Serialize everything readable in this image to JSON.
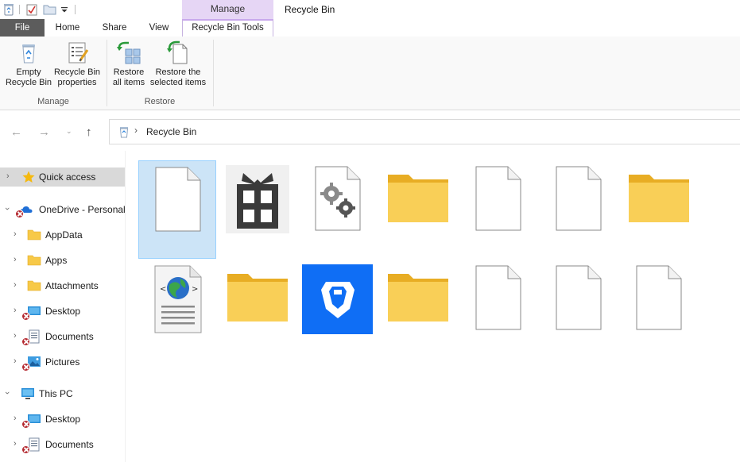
{
  "window": {
    "title": "Recycle Bin",
    "context_tab_group": "Manage"
  },
  "tabs": {
    "file": "File",
    "home": "Home",
    "share": "Share",
    "view": "View",
    "recycle_bin_tools": "Recycle Bin Tools"
  },
  "ribbon": {
    "manage_group": {
      "label": "Manage",
      "empty_line1": "Empty",
      "empty_line2": "Recycle Bin",
      "props_line1": "Recycle Bin",
      "props_line2": "properties"
    },
    "restore_group": {
      "label": "Restore",
      "all_line1": "Restore",
      "all_line2": "all items",
      "sel_line1": "Restore the",
      "sel_line2": "selected items"
    }
  },
  "address": {
    "path": "Recycle Bin"
  },
  "sidebar": {
    "items": [
      {
        "label": "Quick access"
      },
      {
        "label": "OneDrive - Personal"
      },
      {
        "label": "AppData"
      },
      {
        "label": "Apps"
      },
      {
        "label": "Attachments"
      },
      {
        "label": "Desktop"
      },
      {
        "label": "Documents"
      },
      {
        "label": "Pictures"
      },
      {
        "label": "This PC"
      },
      {
        "label": "Desktop"
      },
      {
        "label": "Documents"
      }
    ]
  },
  "content": {
    "items": [
      {
        "icon": "blank-file-icon"
      },
      {
        "icon": "gift-app-icon"
      },
      {
        "icon": "settings-file-icon"
      },
      {
        "icon": "folder-icon"
      },
      {
        "icon": "blank-file-icon"
      },
      {
        "icon": "blank-file-icon"
      },
      {
        "icon": "folder-icon"
      },
      {
        "icon": "html-document-icon"
      },
      {
        "icon": "folder-icon"
      },
      {
        "icon": "shield-app-icon"
      },
      {
        "icon": "folder-icon"
      },
      {
        "icon": "blank-file-icon"
      },
      {
        "icon": "blank-file-icon"
      },
      {
        "icon": "blank-file-icon"
      }
    ]
  },
  "colors": {
    "context_tab": "#e6d6f5",
    "file_tab": "#5c5c5c",
    "selection": "#cce4f7",
    "folder": "#f7c948",
    "error_badge": "#b3262d",
    "app_blue": "#0f6ef5"
  }
}
